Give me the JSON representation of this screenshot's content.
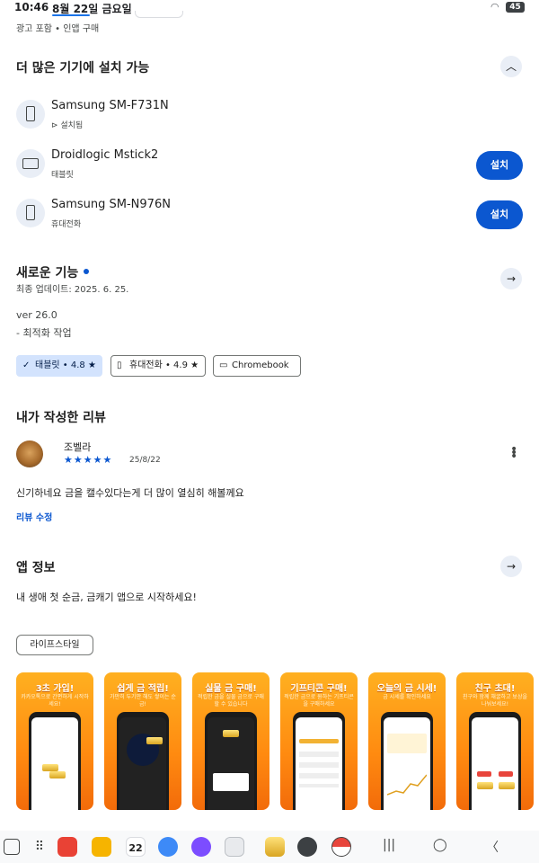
{
  "status_bar": {
    "time": "10:46",
    "date": "8월 22일 금요일",
    "battery": "45"
  },
  "ad_note": "광고 포함 • 인앱 구매",
  "install_more": {
    "title": "더 많은 기기에 설치 가능",
    "devices": [
      {
        "name": "Samsung SM-F731N",
        "status": "⊳ 설치됨",
        "icon": "phone-icon"
      },
      {
        "name": "Droidlogic Mstick2",
        "status": "태블릿",
        "icon": "tablet-icon",
        "button": "설치"
      },
      {
        "name": "Samsung SM-N976N",
        "status": "휴대전화",
        "icon": "phone-icon",
        "button": "설치"
      }
    ]
  },
  "whats_new": {
    "title": "새로운 기능",
    "updated": "최종 업데이트: 2025. 6. 25.",
    "version": "ver 26.0",
    "note": "- 최적화 작업"
  },
  "device_chips": [
    {
      "label": "태블릿 • 4.8 ★",
      "icon": "✓",
      "selected": true
    },
    {
      "label": "휴대전화 • 4.9 ★",
      "icon": "▯",
      "selected": false
    },
    {
      "label": "Chromebook",
      "icon": "▭",
      "selected": false
    }
  ],
  "my_review": {
    "title": "내가 작성한 리뷰",
    "reviewer": "조벨라",
    "stars": "★★★★★",
    "date": "25/8/22",
    "text": "신기하네요 금을 캘수있다는게 더 많이 열심히 해볼께요",
    "edit_label": "리뷰 수정"
  },
  "app_info": {
    "title": "앱 정보",
    "description": "내 생애 첫 순금, 금캐기 앱으로 시작하세요!",
    "category": "라이프스타일"
  },
  "screenshots": [
    {
      "title": "3초 가입!",
      "subtitle": "카카오톡으로 간편하게 시작하세요!"
    },
    {
      "title": "쉽게 금 적립!",
      "subtitle": "가만히 두기만 해도 쌓이는 순금!"
    },
    {
      "title": "실물 금 구매!",
      "subtitle": "적립한 금을 실물 금으로 구매 할 수 있습니다"
    },
    {
      "title": "기프티콘 구매!",
      "subtitle": "적립한 금으로 원하는 기프티콘을 구매하세요"
    },
    {
      "title": "오늘의 금 시세!",
      "subtitle": "금 시세를 확인하세요"
    },
    {
      "title": "친구 초대!",
      "subtitle": "친구와 함께 채굴하고 보상을 나눠보세요!"
    }
  ],
  "calendar_day": "22"
}
